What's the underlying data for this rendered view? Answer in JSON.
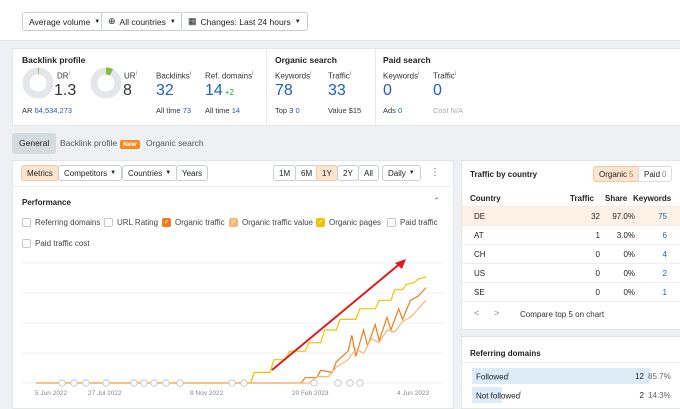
{
  "filters": {
    "volume": "Average volume",
    "countries": "All countries",
    "changes": "Changes: Last 24 hours"
  },
  "backlink_profile": {
    "title": "Backlink profile",
    "dr_label": "DR",
    "dr_value": "1.3",
    "ur_label": "UR",
    "ur_value": "8",
    "ar_label": "AR",
    "ar_value": "64,534,273",
    "backlinks_label": "Backlinks",
    "backlinks_value": "32",
    "backlinks_sub_label": "All time",
    "backlinks_sub_value": "73",
    "refdomains_label": "Ref. domains",
    "refdomains_value": "14",
    "refdomains_delta": "+2",
    "refdomains_sub_label": "All time",
    "refdomains_sub_value": "14"
  },
  "organic_search": {
    "title": "Organic search",
    "keywords_label": "Keywords",
    "keywords_value": "78",
    "keywords_sub_label": "Top 3",
    "keywords_sub_value": "0",
    "traffic_label": "Traffic",
    "traffic_value": "33",
    "traffic_sub": "Value $15"
  },
  "paid_search": {
    "title": "Paid search",
    "keywords_label": "Keywords",
    "keywords_value": "0",
    "keywords_sub_label": "Ads",
    "keywords_sub_value": "0",
    "traffic_label": "Traffic",
    "traffic_value": "0",
    "traffic_sub": "Cost N/A"
  },
  "tabs": {
    "general": "General",
    "backlink_profile": "Backlink profile",
    "new_badge": "New",
    "organic_search": "Organic search"
  },
  "toolbar": {
    "metrics": "Metrics",
    "competitors": "Competitors",
    "countries": "Countries",
    "years": "Years",
    "ranges": [
      "1M",
      "6M",
      "1Y",
      "2Y",
      "All"
    ],
    "active_range": "1Y",
    "interval": "Daily"
  },
  "performance": {
    "title": "Performance",
    "checkboxes": [
      {
        "label": "Referring domains",
        "checked": false
      },
      {
        "label": "URL Rating",
        "checked": false
      },
      {
        "label": "Organic traffic",
        "checked": true
      },
      {
        "label": "Organic traffic value",
        "checked": true
      },
      {
        "label": "Organic pages",
        "checked": true
      },
      {
        "label": "Paid traffic",
        "checked": false
      },
      {
        "label": "Paid traffic cost",
        "checked": false
      }
    ],
    "x_ticks": [
      "5 Jun 2022",
      "27 Jul 2022",
      "8 Nov 2022",
      "20 Feb 2023",
      "4 Jun 2023"
    ]
  },
  "chart_data": {
    "type": "line",
    "x_ticks": [
      "5 Jun 2022",
      "27 Jul 2022",
      "8 Nov 2022",
      "20 Feb 2023",
      "4 Jun 2023"
    ],
    "series": [
      {
        "name": "Organic pages",
        "color": "#f2c200",
        "points": [
          [
            0,
            0
          ],
          [
            0.55,
            0
          ],
          [
            0.56,
            0.1
          ],
          [
            0.6,
            0.1
          ],
          [
            0.61,
            0.22
          ],
          [
            0.64,
            0.22
          ],
          [
            0.65,
            0.3
          ],
          [
            0.69,
            0.3
          ],
          [
            0.7,
            0.38
          ],
          [
            0.73,
            0.38
          ],
          [
            0.74,
            0.5
          ],
          [
            0.77,
            0.5
          ],
          [
            0.78,
            0.6
          ],
          [
            0.82,
            0.6
          ],
          [
            0.83,
            0.7
          ],
          [
            0.87,
            0.7
          ],
          [
            0.88,
            0.78
          ],
          [
            0.91,
            0.78
          ],
          [
            0.92,
            0.88
          ],
          [
            0.94,
            0.88
          ],
          [
            0.95,
            0.93
          ],
          [
            0.97,
            0.95
          ],
          [
            0.98,
            0.98
          ],
          [
            1,
            1
          ]
        ]
      },
      {
        "name": "Organic traffic",
        "color": "#f07d1a",
        "points": [
          [
            0,
            0
          ],
          [
            0.68,
            0
          ],
          [
            0.69,
            0.05
          ],
          [
            0.72,
            0.05
          ],
          [
            0.73,
            0.12
          ],
          [
            0.76,
            0.1
          ],
          [
            0.77,
            0.2
          ],
          [
            0.8,
            0.3
          ],
          [
            0.81,
            0.45
          ],
          [
            0.82,
            0.25
          ],
          [
            0.84,
            0.5
          ],
          [
            0.85,
            0.35
          ],
          [
            0.87,
            0.55
          ],
          [
            0.88,
            0.4
          ],
          [
            0.9,
            0.62
          ],
          [
            0.91,
            0.5
          ],
          [
            0.93,
            0.7
          ],
          [
            0.94,
            0.6
          ],
          [
            0.96,
            0.78
          ],
          [
            0.98,
            0.82
          ],
          [
            1,
            0.9
          ]
        ]
      },
      {
        "name": "Organic traffic value",
        "color": "#f7b97a",
        "points": [
          [
            0,
            0
          ],
          [
            0.7,
            0
          ],
          [
            0.72,
            0.06
          ],
          [
            0.75,
            0.06
          ],
          [
            0.77,
            0.15
          ],
          [
            0.8,
            0.22
          ],
          [
            0.82,
            0.32
          ],
          [
            0.84,
            0.28
          ],
          [
            0.86,
            0.42
          ],
          [
            0.88,
            0.38
          ],
          [
            0.9,
            0.5
          ],
          [
            0.92,
            0.48
          ],
          [
            0.94,
            0.58
          ],
          [
            0.96,
            0.62
          ],
          [
            0.98,
            0.7
          ],
          [
            1,
            0.78
          ]
        ]
      }
    ]
  },
  "traffic_by_country": {
    "title": "Traffic by country",
    "seg_organic": "Organic",
    "seg_organic_count": "5",
    "seg_paid": "Paid",
    "seg_paid_count": "0",
    "headers": [
      "Country",
      "Traffic",
      "Share",
      "Keywords"
    ],
    "rows": [
      {
        "country": "DE",
        "traffic": "32",
        "share": "97.0%",
        "keywords": "75"
      },
      {
        "country": "AT",
        "traffic": "1",
        "share": "3.0%",
        "keywords": "6"
      },
      {
        "country": "CH",
        "traffic": "0",
        "share": "0%",
        "keywords": "4"
      },
      {
        "country": "US",
        "traffic": "0",
        "share": "0%",
        "keywords": "2"
      },
      {
        "country": "SE",
        "traffic": "0",
        "share": "0%",
        "keywords": "1"
      }
    ],
    "compare_label": "Compare top 5 on chart"
  },
  "referring_domains": {
    "title": "Referring domains",
    "rows": [
      {
        "label": "Followed",
        "value": "12",
        "pct": "85.7%",
        "fill": 0.857
      },
      {
        "label": "Not followed",
        "value": "2",
        "pct": "14.3%",
        "fill": 0.143
      }
    ]
  }
}
